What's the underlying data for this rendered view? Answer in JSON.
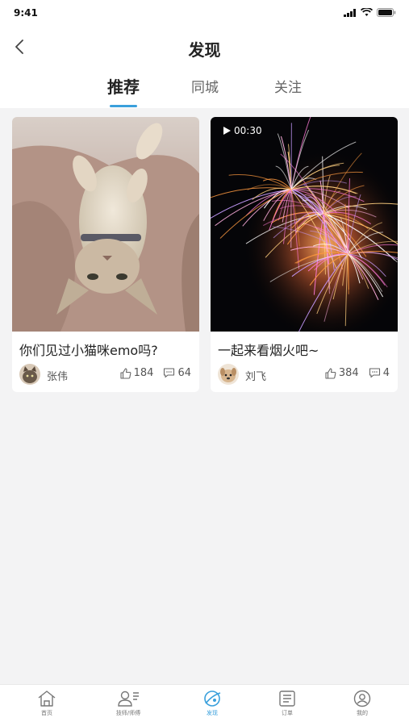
{
  "status_bar": {
    "time": "9:41"
  },
  "header": {
    "title": "发现"
  },
  "tabs": [
    {
      "label": "推荐",
      "active": true
    },
    {
      "label": "同城",
      "active": false
    },
    {
      "label": "关注",
      "active": false
    }
  ],
  "posts": [
    {
      "title": "你们见过小猫咪emo吗?",
      "author": "张伟",
      "likes": "184",
      "comments": "64",
      "avatar_icon": "cat-avatar",
      "image": "cat-photo"
    },
    {
      "title": "一起来看烟火吧~",
      "author": "刘飞",
      "likes": "384",
      "comments": "4",
      "avatar_icon": "dog-avatar",
      "image": "fireworks-video",
      "duration": "00:30"
    }
  ],
  "bottom_nav": [
    {
      "label": "首页",
      "icon": "home-icon",
      "active": false
    },
    {
      "label": "技师/师傅",
      "icon": "technician-icon",
      "active": false
    },
    {
      "label": "发现",
      "icon": "discover-icon",
      "active": true
    },
    {
      "label": "订单",
      "icon": "order-icon",
      "active": false
    },
    {
      "label": "我的",
      "icon": "profile-icon",
      "active": false
    }
  ],
  "colors": {
    "accent": "#3aa0dc",
    "background": "#f3f3f4"
  }
}
